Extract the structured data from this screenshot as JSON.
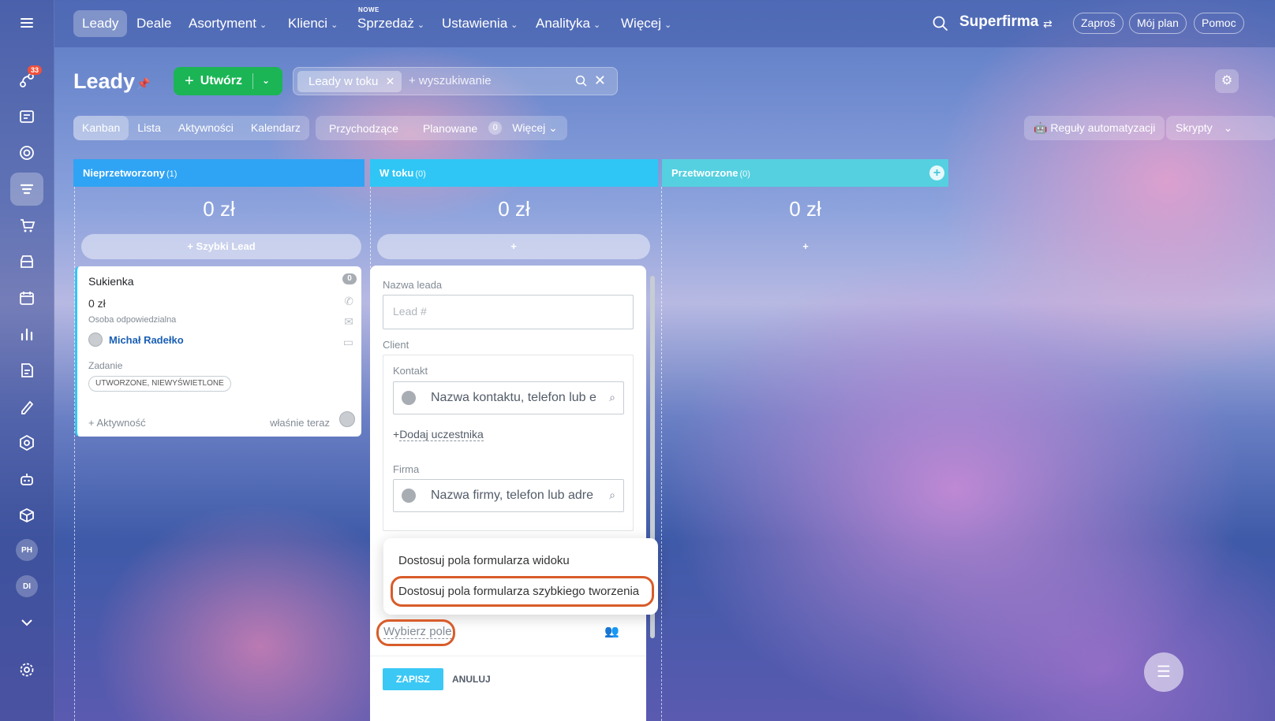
{
  "topnav": {
    "items": [
      {
        "label": "Leady",
        "active": true
      },
      {
        "label": "Deale"
      },
      {
        "label": "Asortyment",
        "chevron": true
      },
      {
        "label": "Klienci",
        "chevron": true
      },
      {
        "label": "Sprzedaż",
        "chevron": true,
        "badge": "NOWE"
      },
      {
        "label": "Ustawienia",
        "chevron": true
      },
      {
        "label": "Analityka",
        "chevron": true
      },
      {
        "label": "Więcej",
        "chevron": true
      }
    ],
    "brand": "Superfirma",
    "buttons": [
      "Zaproś",
      "Mój plan",
      "Pomoc"
    ]
  },
  "rail": {
    "notifications_badge": "33",
    "avatars": [
      "PH",
      "DI"
    ]
  },
  "header": {
    "title": "Leady",
    "create_label": "Utwórz",
    "filter_chip": "Leady w toku",
    "search_placeholder": "+ wyszukiwanie"
  },
  "views": {
    "tabs": [
      {
        "label": "Kanban",
        "active": true
      },
      {
        "label": "Lista"
      },
      {
        "label": "Aktywności"
      },
      {
        "label": "Kalendarz"
      }
    ],
    "counters": [
      "Przychodzące",
      "Planowane"
    ],
    "counter_badge": "0",
    "more_label": "Więcej",
    "automation_label": "Reguły automatyzacji",
    "scripts_label": "Skrypty"
  },
  "columns": [
    {
      "title": "Nieprzetworzony",
      "count": "(1)",
      "sum": "0 zł",
      "color": "#2fa4f5",
      "quick_label": "+ Szybki Lead"
    },
    {
      "title": "W toku",
      "count": "(0)",
      "sum": "0 zł",
      "color": "#2fc6f6",
      "quick_label": "+"
    },
    {
      "title": "Przetworzone",
      "count": "(0)",
      "sum": "0 zł",
      "color": "#55d0e0",
      "quick_label": "+"
    }
  ],
  "card": {
    "title": "Sukienka",
    "amount": "0 zł",
    "responsible_label": "Osoba odpowiedzialna",
    "user": "Michał Radełko",
    "task_label": "Zadanie",
    "task_tag": "UTWORZONE, NIEWYŚWIETLONE",
    "activity": "+ Aktywność",
    "time": "właśnie teraz",
    "counter": "0"
  },
  "form": {
    "lead_name_label": "Nazwa leada",
    "lead_name_placeholder": "Lead #",
    "client_label": "Client",
    "contact_label": "Kontakt",
    "contact_placeholder": "Nazwa kontaktu, telefon lub e",
    "add_participant": "Dodaj uczestnika",
    "company_label": "Firma",
    "company_placeholder": "Nazwa firmy, telefon lub adre",
    "menu_items": [
      "Dostosuj pola formularza widoku",
      "Dostosuj pola formularza szybkiego tworzenia"
    ],
    "choose_field": "Wybierz pole",
    "save": "ZAPISZ",
    "cancel": "ANULUJ"
  }
}
